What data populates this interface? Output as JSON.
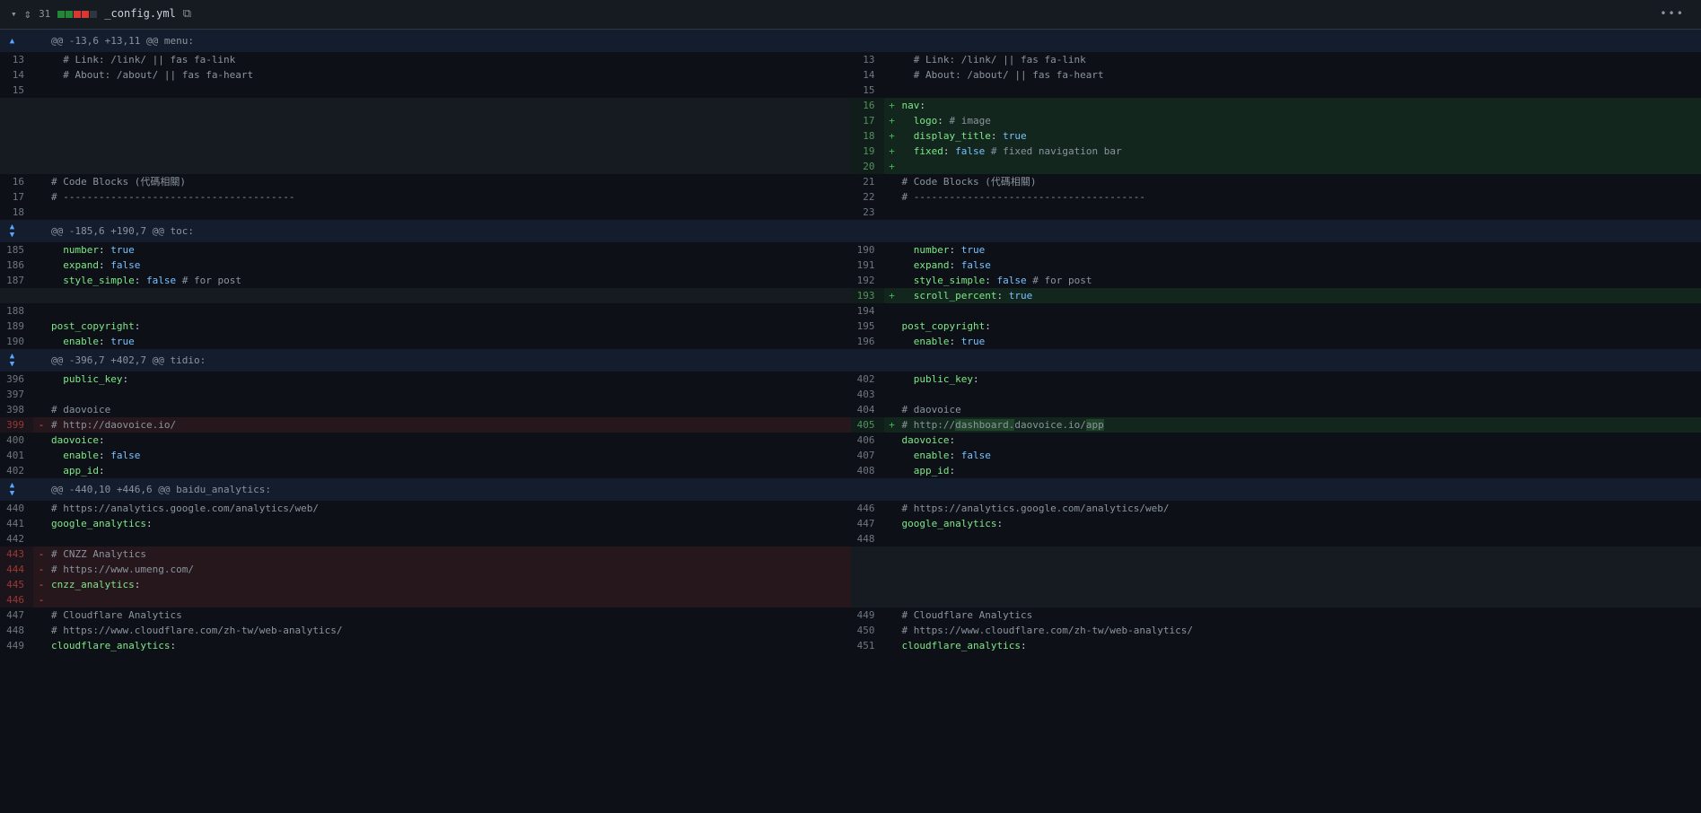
{
  "header": {
    "line_count": "31",
    "filename": "_config.yml"
  },
  "hunks": [
    {
      "header": "@@ -13,6 +13,11 @@ menu:"
    },
    {
      "header": "@@ -185,6 +190,7 @@ toc:"
    },
    {
      "header": "@@ -396,7 +402,7 @@ tidio:"
    },
    {
      "header": "@@ -440,10 +446,6 @@ baidu_analytics:"
    }
  ],
  "diff": {
    "ctx13l": {
      "ln_l": "13",
      "ln_r": "13",
      "t1": "  ",
      "c1": "# Link: /link/ || fas fa-link"
    },
    "ctx14l": {
      "ln_l": "14",
      "ln_r": "14",
      "t1": "  ",
      "c1": "# About: /about/ || fas fa-heart"
    },
    "ctx15l": {
      "ln_l": "15",
      "ln_r": "15"
    },
    "add16": {
      "ln_r": "16",
      "k1": "nav",
      "p1": ":"
    },
    "add17": {
      "ln_r": "17",
      "k1": "logo",
      "p1": ": ",
      "c1": "# image"
    },
    "add18": {
      "ln_r": "18",
      "k1": "display_title",
      "p1": ": ",
      "b1": "true"
    },
    "add19": {
      "ln_r": "19",
      "k1": "fixed",
      "p1": ": ",
      "b1": "false",
      "c1": " # fixed navigation bar"
    },
    "add20": {
      "ln_r": "20"
    },
    "ctx16": {
      "ln_l": "16",
      "ln_r": "21",
      "c1": "# Code Blocks (代碼相關)"
    },
    "ctx17": {
      "ln_l": "17",
      "ln_r": "22",
      "c1": "# ---------------------------------------"
    },
    "ctx18": {
      "ln_l": "18",
      "ln_r": "23"
    },
    "ctx185": {
      "ln_l": "185",
      "ln_r": "190",
      "k1": "number",
      "p1": ": ",
      "b1": "true"
    },
    "ctx186": {
      "ln_l": "186",
      "ln_r": "191",
      "k1": "expand",
      "p1": ": ",
      "b1": "false"
    },
    "ctx187": {
      "ln_l": "187",
      "ln_r": "192",
      "k1": "style_simple",
      "p1": ": ",
      "b1": "false",
      "c1": " # for post"
    },
    "add193": {
      "ln_r": "193",
      "k1": "scroll_percent",
      "p1": ": ",
      "b1": "true"
    },
    "ctx188": {
      "ln_l": "188",
      "ln_r": "194"
    },
    "ctx189": {
      "ln_l": "189",
      "ln_r": "195",
      "k1": "post_copyright",
      "p1": ":"
    },
    "ctx190": {
      "ln_l": "190",
      "ln_r": "196",
      "k1": "enable",
      "p1": ": ",
      "b1": "true"
    },
    "ctx396": {
      "ln_l": "396",
      "ln_r": "402",
      "k1": "public_key",
      "p1": ":"
    },
    "ctx397": {
      "ln_l": "397",
      "ln_r": "403"
    },
    "ctx398": {
      "ln_l": "398",
      "ln_r": "404",
      "c1": "# daovoice"
    },
    "del399": {
      "ln_l": "399",
      "c1_a": "# http://",
      "c1_b": "daovoice.io/"
    },
    "add405": {
      "ln_r": "405",
      "c1_a": "# http://",
      "c1_x": "dashboard.",
      "c1_b": "daovoice.io/",
      "c1_y": "app"
    },
    "ctx400": {
      "ln_l": "400",
      "ln_r": "406",
      "k1": "daovoice",
      "p1": ":"
    },
    "ctx401": {
      "ln_l": "401",
      "ln_r": "407",
      "k1": "enable",
      "p1": ": ",
      "b1": "false"
    },
    "ctx402": {
      "ln_l": "402",
      "ln_r": "408",
      "k1": "app_id",
      "p1": ":"
    },
    "ctx440": {
      "ln_l": "440",
      "ln_r": "446",
      "c1": "# https://analytics.google.com/analytics/web/"
    },
    "ctx441": {
      "ln_l": "441",
      "ln_r": "447",
      "k1": "google_analytics",
      "p1": ":"
    },
    "ctx442": {
      "ln_l": "442",
      "ln_r": "448"
    },
    "del443": {
      "ln_l": "443",
      "c1": "# CNZZ Analytics"
    },
    "del444": {
      "ln_l": "444",
      "c1": "# https://www.umeng.com/"
    },
    "del445": {
      "ln_l": "445",
      "k1": "cnzz_analytics",
      "p1": ":"
    },
    "del446": {
      "ln_l": "446"
    },
    "ctx447": {
      "ln_l": "447",
      "ln_r": "449",
      "c1": "# Cloudflare Analytics"
    },
    "ctx448": {
      "ln_l": "448",
      "ln_r": "450",
      "c1": "# https://www.cloudflare.com/zh-tw/web-analytics/"
    },
    "ctx449": {
      "ln_l": "449",
      "ln_r": "451",
      "k1": "cloudflare_analytics",
      "p1": ":"
    }
  }
}
